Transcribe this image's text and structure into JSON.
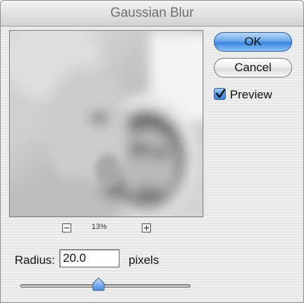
{
  "window": {
    "title": "Gaussian Blur"
  },
  "buttons": {
    "ok_label": "OK",
    "cancel_label": "Cancel"
  },
  "preview_toggle": {
    "label": "Preview",
    "checked": true
  },
  "zoom": {
    "level": "13%",
    "zoom_out_icon": "minus-icon",
    "zoom_in_icon": "plus-icon"
  },
  "radius": {
    "label": "Radius:",
    "value": "20.0",
    "units": "pixels",
    "slider_fraction": 0.46
  },
  "colors": {
    "accent": "#3b86e0",
    "dialog_bg": "#ececec",
    "title_text": "#6f6f6f"
  }
}
